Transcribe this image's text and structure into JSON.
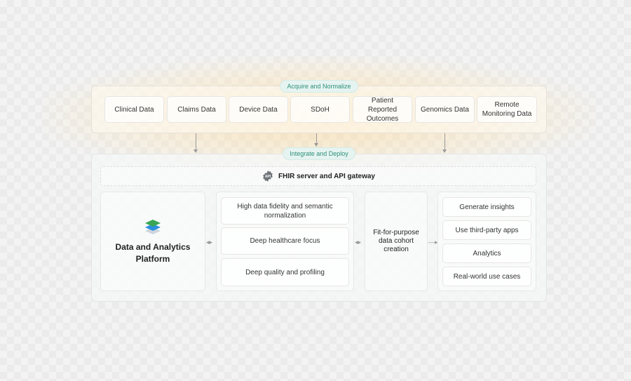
{
  "acquire": {
    "label": "Acquire and Normalize",
    "sources": [
      "Clinical Data",
      "Claims Data",
      "Device Data",
      "SDoH",
      "Patient Reported Outcomes",
      "Genomics Data",
      "Remote Monitoring Data"
    ]
  },
  "integrate": {
    "label": "Integrate and Deploy",
    "gateway": {
      "icon": "api-gear-icon",
      "icon_text": "API",
      "label": "FHIR server and API gateway"
    },
    "platform": {
      "icon": "layers-icon",
      "label": "Data and Analytics Platform"
    },
    "features": [
      "High data fidelity and semantic normalization",
      "Deep healthcare focus",
      "Deep quality and profiling"
    ],
    "cohort": "Fit-for-purpose data cohort creation",
    "outcomes": [
      "Generate insights",
      "Use third-party apps",
      "Analytics",
      "Real-world use cases"
    ]
  },
  "colors": {
    "accent": "#2e8f7a",
    "pill_bg": "#e6f4f1",
    "layer_green": "#3aa655",
    "layer_blue": "#2d8ee0"
  }
}
